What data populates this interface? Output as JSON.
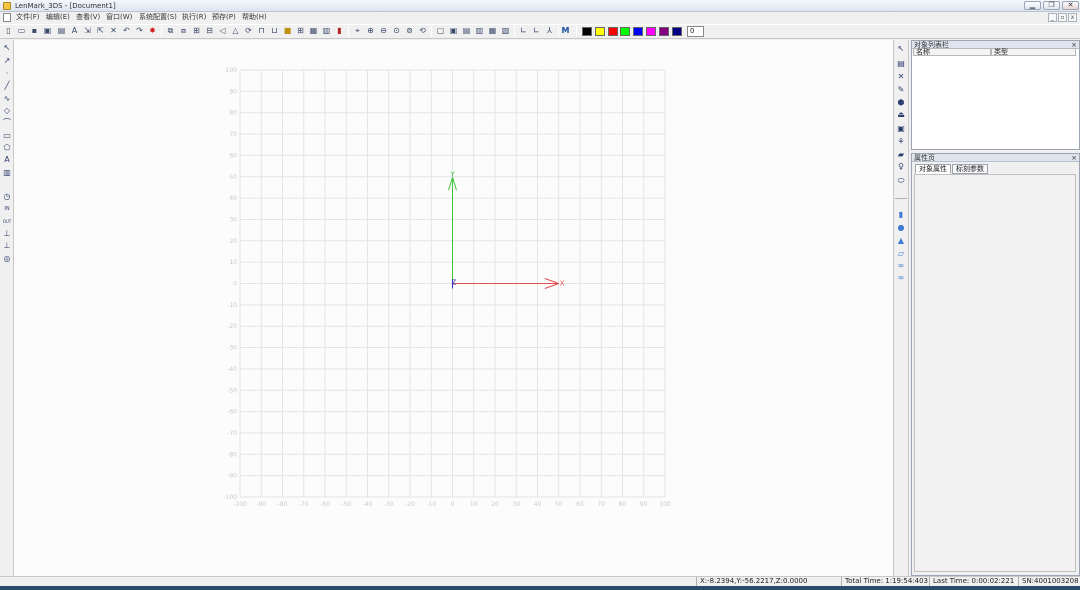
{
  "window": {
    "title": "LenMark_3DS - [Document1]",
    "buttons": {
      "minimize": "▁",
      "restore": "❐",
      "close": "✕"
    }
  },
  "menu": {
    "items": [
      "文件(F)",
      "编辑(E)",
      "查看(V)",
      "窗口(W)",
      "系统配置(S)",
      "执行(R)",
      "预存(P)",
      "帮助(H)"
    ],
    "mdi_buttons": [
      "_",
      "▫",
      "x"
    ]
  },
  "toolbar": {
    "color_swatches": [
      "#000000",
      "#ffff00",
      "#ff0000",
      "#00ff00",
      "#0000ff",
      "#ff00ff",
      "#800080",
      "#000080"
    ],
    "index_value": "0",
    "m_label": "M"
  },
  "left_tools": [
    {
      "name": "select-icon",
      "glyph": "↖"
    },
    {
      "name": "node-edit-icon",
      "glyph": "↗"
    },
    {
      "name": "point-icon",
      "glyph": "·"
    },
    {
      "name": "line-icon",
      "glyph": "╱"
    },
    {
      "name": "curve-icon",
      "glyph": "∿"
    },
    {
      "name": "circle-icon",
      "glyph": "◇"
    },
    {
      "name": "arc-icon",
      "glyph": "⌒"
    },
    {
      "name": "rectangle-icon",
      "glyph": "▭"
    },
    {
      "name": "polygon-icon",
      "glyph": "⬠"
    },
    {
      "name": "text-icon",
      "glyph": "A"
    },
    {
      "name": "barcode-icon",
      "glyph": "▥"
    },
    {
      "name": "clock-icon",
      "glyph": "◷"
    },
    {
      "name": "input-icon",
      "glyph": "IN"
    },
    {
      "name": "output-icon",
      "glyph": "OUT"
    },
    {
      "name": "axis-icon",
      "glyph": "⊥"
    },
    {
      "name": "axis-3d-icon",
      "glyph": "⊥"
    },
    {
      "name": "rotary-icon",
      "glyph": "◎"
    }
  ],
  "right_tools": [
    {
      "name": "pointer-icon",
      "glyph": "↖"
    },
    {
      "name": "image-icon",
      "glyph": "▤"
    },
    {
      "name": "delete-icon",
      "glyph": "✕"
    },
    {
      "name": "pen-icon",
      "glyph": "✎"
    },
    {
      "name": "fill-icon",
      "glyph": "⬢"
    },
    {
      "name": "layer-icon",
      "glyph": "⏏"
    },
    {
      "name": "frame-icon",
      "glyph": "▣"
    },
    {
      "name": "tree-icon",
      "glyph": "⚘"
    },
    {
      "name": "cube-icon",
      "glyph": "▰"
    },
    {
      "name": "person-icon",
      "glyph": "♀"
    },
    {
      "name": "ellipse-icon",
      "glyph": "⬭"
    },
    {
      "name": "cylinder-icon",
      "glyph": "▮"
    },
    {
      "name": "sphere-icon",
      "glyph": "●"
    },
    {
      "name": "cone-icon",
      "glyph": "▲"
    },
    {
      "name": "plane-icon",
      "glyph": "▱"
    },
    {
      "name": "torus-icon",
      "glyph": "∞"
    },
    {
      "name": "link-icon",
      "glyph": "∞"
    }
  ],
  "object_list": {
    "title": "对象列表栏",
    "close": "×",
    "columns": [
      "名称",
      "类型"
    ]
  },
  "properties": {
    "title": "属性页",
    "close": "×",
    "tabs": [
      "对象属性",
      "标刻参数"
    ]
  },
  "viewport": {
    "x_ticks": [
      "-100",
      "-90",
      "-80",
      "-70",
      "-60",
      "-50",
      "-40",
      "-30",
      "-20",
      "-10",
      "0",
      "10",
      "20",
      "30",
      "40",
      "50",
      "60",
      "70",
      "80",
      "90",
      "100"
    ],
    "y_ticks": [
      "100",
      "90",
      "80",
      "70",
      "60",
      "50",
      "40",
      "30",
      "20",
      "10",
      "0",
      "-10",
      "-20",
      "-30",
      "-40",
      "-50",
      "-60",
      "-70",
      "-80",
      "-90",
      "-100"
    ],
    "axis_labels": {
      "x": "X",
      "y": "Y",
      "z": "Z"
    },
    "axis_colors": {
      "x": "#e05050",
      "y": "#40c040",
      "z": "#3030c0"
    }
  },
  "status": {
    "coords": "X:-8.2394,Y:-56.2217,Z:0.0000",
    "total_time": "Total Time: 1:19:54:403",
    "last_time": "Last Time: 0:00:02:221",
    "serial": "SN:4001003208"
  }
}
